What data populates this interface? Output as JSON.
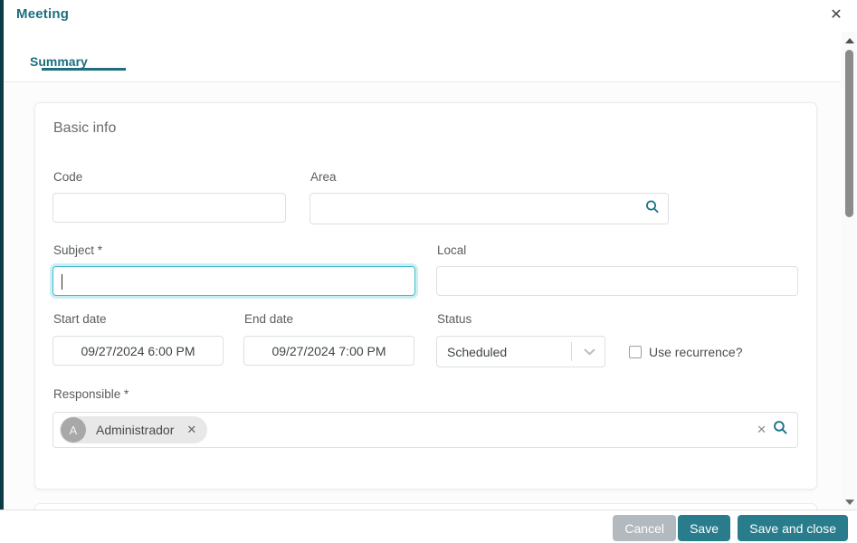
{
  "dialog": {
    "title": "Meeting",
    "close_glyph": "✕"
  },
  "tabs": [
    {
      "label": "Summary",
      "active": true
    }
  ],
  "basic_info": {
    "section_title": "Basic info",
    "fields": {
      "code": {
        "label": "Code",
        "value": ""
      },
      "area": {
        "label": "Area",
        "value": ""
      },
      "subject": {
        "label": "Subject *",
        "value": "",
        "focused": true
      },
      "local": {
        "label": "Local",
        "value": ""
      },
      "start_date": {
        "label": "Start date",
        "value": "09/27/2024 6:00 PM"
      },
      "end_date": {
        "label": "End date",
        "value": "09/27/2024 7:00 PM"
      },
      "status": {
        "label": "Status",
        "value": "Scheduled"
      },
      "use_recurrence": {
        "label": "Use recurrence?",
        "checked": false
      },
      "responsible": {
        "label": "Responsible *",
        "chip": {
          "initial": "A",
          "name": "Administrador",
          "remove_glyph": "✕"
        },
        "clear_glyph": "✕"
      }
    }
  },
  "footer": {
    "cancel_label": "Cancel",
    "save_label": "Save",
    "save_and_close_label": "Save and close"
  },
  "icons": {
    "area_search": "search-icon",
    "responsible_search": "search-icon",
    "status_chevron": "chevron-down-icon"
  },
  "colors": {
    "accent_teal": "#1b6f7f",
    "button_teal": "#297c8c",
    "cancel_gray": "#b2b9bf",
    "focus_cyan": "#45bccf",
    "edge_strip": "#0c3b46"
  }
}
